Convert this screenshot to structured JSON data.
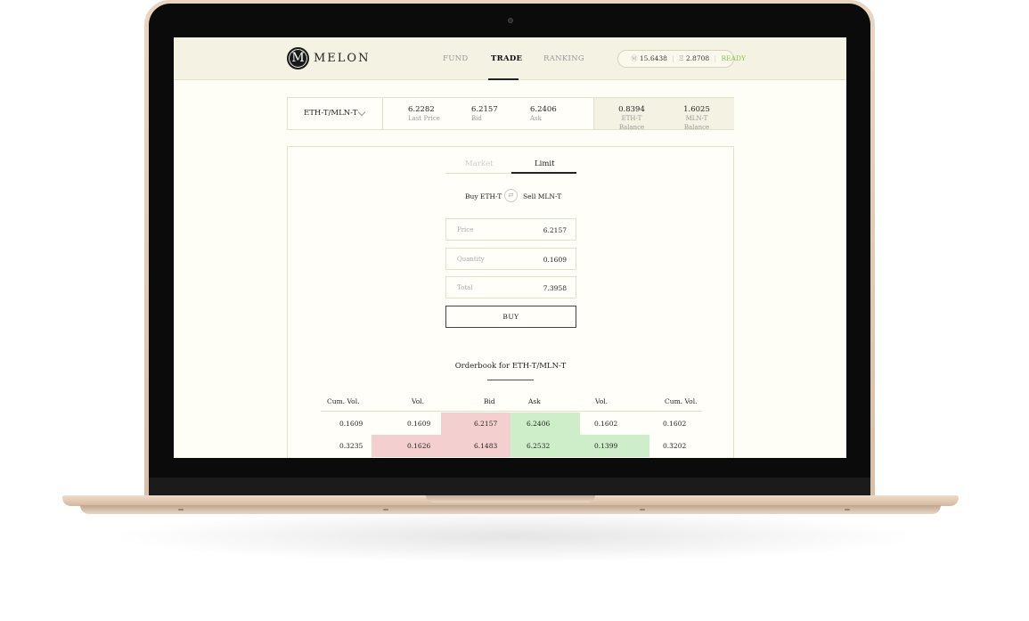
{
  "app": {
    "logo_letter": "M",
    "logo_text": "MELON"
  },
  "nav": {
    "fund": "FUND",
    "trade": "TRADE",
    "ranking": "RANKING"
  },
  "status": {
    "mln_symbol": "Ⓜ",
    "mln_value": "15.6438",
    "eth_symbol": "Ξ",
    "eth_value": "2.8708",
    "state": "READY"
  },
  "ticker": {
    "pair": "ETH-T/MLN-T",
    "last_price": "6.2282",
    "last_price_label": "Last Price",
    "bid": "6.2157",
    "bid_label": "Bid",
    "ask": "6.2406",
    "ask_label": "Ask",
    "eth_balance": "0.8394",
    "eth_balance_label": "ETH-T Balance",
    "mln_balance": "1.6025",
    "mln_balance_label": "MLN-T Balance"
  },
  "order_form": {
    "tabs": [
      {
        "label": "Market",
        "active": false
      },
      {
        "label": "Limit",
        "active": true
      }
    ],
    "buy_label": "Buy ETH-T",
    "swap_icon": "⇄",
    "sell_label": "Sell MLN-T",
    "price_label": "Price",
    "price_value": "6.2157",
    "quantity_label": "Quantity",
    "quantity_value": "0.1609",
    "total_label": "Total",
    "total_value": "7.3958",
    "submit_label": "BUY"
  },
  "orderbook": {
    "title": "Orderbook for ETH-T/MLN-T",
    "headers": [
      "Cum. Vol.",
      "Vol.",
      "Bid",
      "Ask",
      "Vol.",
      "Cum. Vol."
    ],
    "rows": [
      {
        "bid_cum": "0.1609",
        "bid_vol": "0.1609",
        "bid": "6.2157",
        "ask": "6.2406",
        "ask_vol": "0.1602",
        "ask_cum": "0.1602",
        "bid_depth": 0.5,
        "ask_depth": 0.5
      },
      {
        "bid_cum": "0.3235",
        "bid_vol": "0.1626",
        "bid": "6.1483",
        "ask": "6.2532",
        "ask_vol": "0.1399",
        "ask_cum": "0.3202",
        "bid_depth": 1.0,
        "ask_depth": 1.0
      }
    ]
  },
  "colors": {
    "bid": "#f3cfd0",
    "ask": "#cdeec8",
    "ready": "#8cc24a"
  }
}
